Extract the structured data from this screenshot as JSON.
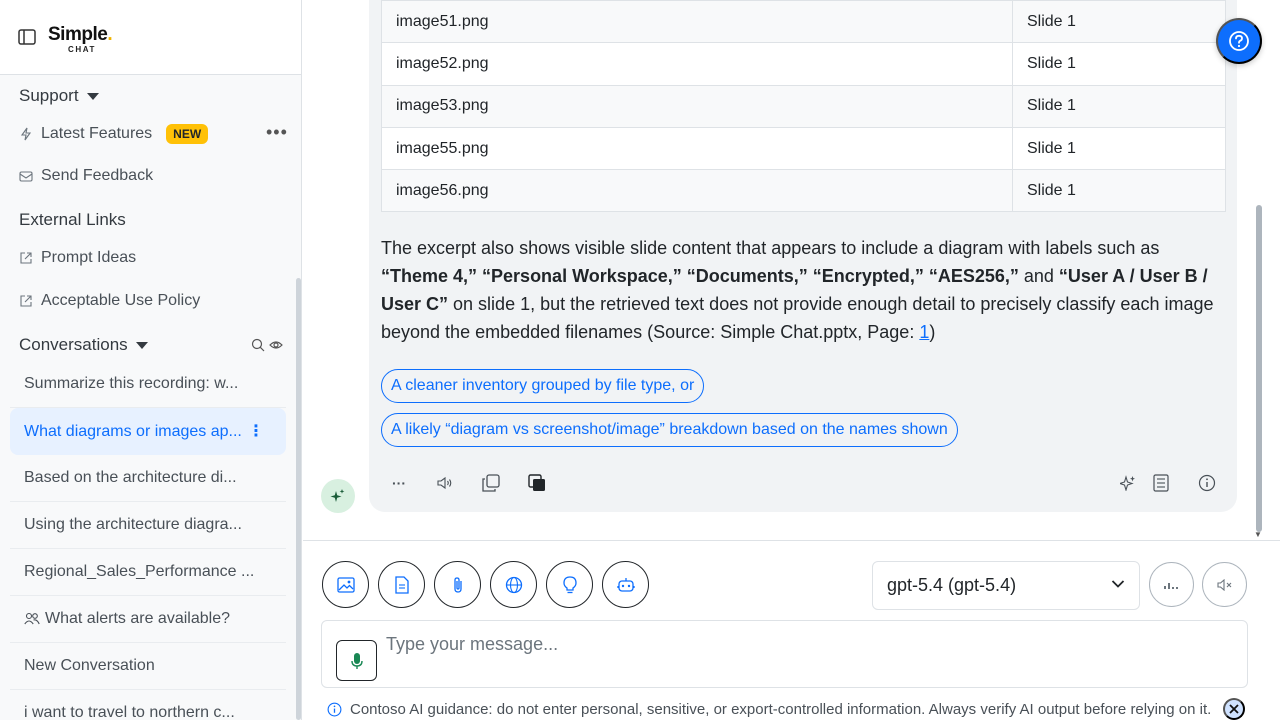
{
  "brand": {
    "name": "Simple",
    "dot": ".",
    "sub": "CHAT"
  },
  "sidebar": {
    "support_title": "Support",
    "latest_features": "Latest Features",
    "new_badge": "NEW",
    "send_feedback": "Send Feedback",
    "external_links_title": "External Links",
    "prompt_ideas": "Prompt Ideas",
    "acceptable_use": "Acceptable Use Policy",
    "conversations_title": "Conversations",
    "conversations": [
      {
        "title": "Summarize this recording: w..."
      },
      {
        "title": "What diagrams or images ap...",
        "active": true
      },
      {
        "title": "Based on the architecture di..."
      },
      {
        "title": "Using the architecture diagra..."
      },
      {
        "title": "Regional_Sales_Performance ..."
      },
      {
        "title": "What alerts are available?",
        "icon": "people-icon"
      },
      {
        "title": "New Conversation"
      },
      {
        "title": "i want to travel to northern c..."
      }
    ]
  },
  "table": {
    "rows": [
      {
        "file": "image51.png",
        "slide": "Slide 1"
      },
      {
        "file": "image52.png",
        "slide": "Slide 1"
      },
      {
        "file": "image53.png",
        "slide": "Slide 1"
      },
      {
        "file": "image55.png",
        "slide": "Slide 1"
      },
      {
        "file": "image56.png",
        "slide": "Slide 1"
      }
    ]
  },
  "answer": {
    "p1": "The excerpt also shows visible slide content that appears to include a diagram with labels such as ",
    "b1": "“Theme 4,” “Personal Workspace,” “Documents,” “Encrypted,” “AES256,”",
    "p2": " and ",
    "b2": "“User A / User B / User C”",
    "p3": " on slide 1, but the retrieved text does not provide enough detail to precisely classify each image beyond the embedded filenames (Source: Simple Chat.pptx, Page: ",
    "page_link": "1",
    "p4": ")"
  },
  "followups": [
    "A cleaner inventory grouped by file type, or",
    "A likely “diagram vs screenshot/image” breakdown based on the names shown"
  ],
  "actions": {
    "more": "···"
  },
  "composer": {
    "model": "gpt-5.4 (gpt-5.4)",
    "placeholder": "Type your message...",
    "guidance": "Contoso AI guidance: do not enter personal, sensitive, or export-controlled information. Always verify AI output before relying on it."
  },
  "colors": {
    "accent": "#0d6efd",
    "badge": "#ffc107",
    "avatar_bg": "#d8f0e0"
  }
}
